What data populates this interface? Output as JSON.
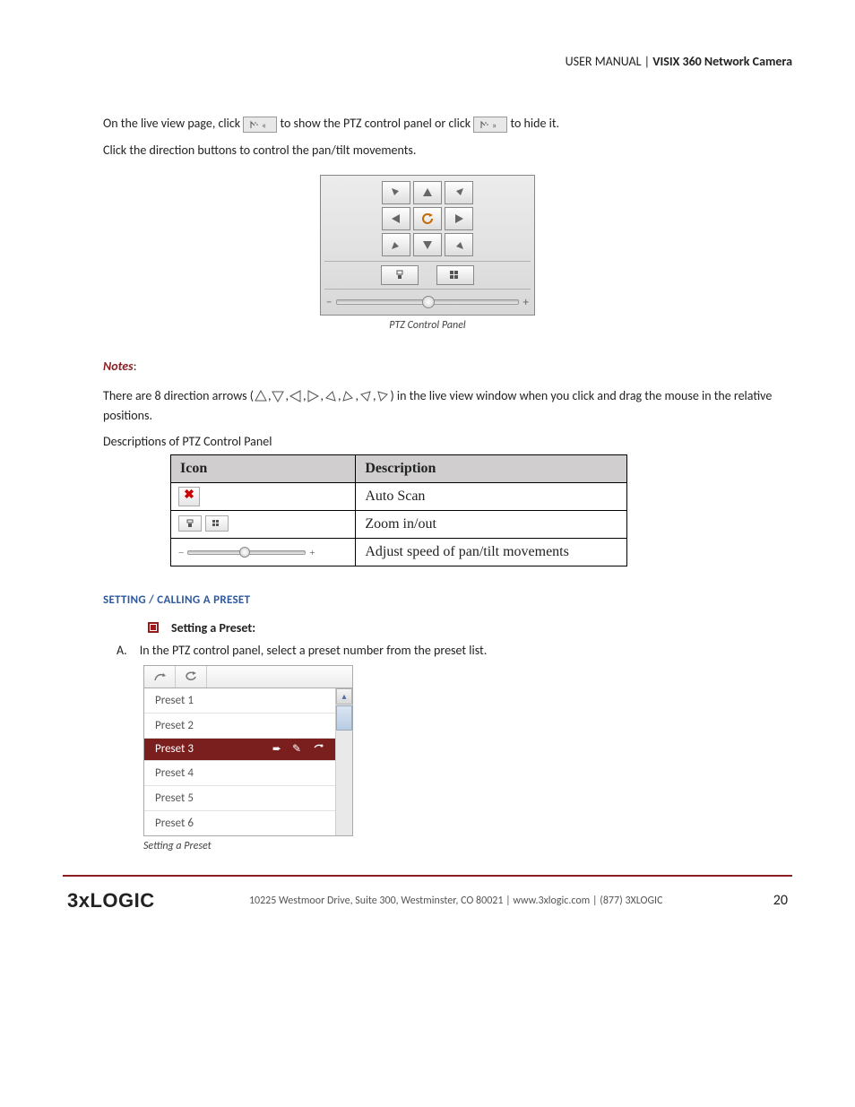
{
  "header": {
    "left": "USER MANUAL | ",
    "bold": "VISIX 360 Network Camera"
  },
  "paragraphs": {
    "p1a": "On the live view page, click ",
    "p1b": " to show the PTZ control panel or click ",
    "p1c": " to hide it.",
    "p2": "Click the direction buttons to control the pan/tilt movements.",
    "caption1": "PTZ Control Panel",
    "notes_label": "Notes",
    "notes_colon": ":",
    "p3a": "There are 8 direction arrows (",
    "p3b": ") in the live view window when you click and drag the mouse in the relative positions.",
    "p4": "Descriptions of PTZ Control Panel",
    "section": "SETTING / CALLING A PRESET",
    "bullet1": "Setting a Preset:",
    "stepA": "A. In the PTZ control panel, select a preset number from the preset list.",
    "caption2": "Setting a Preset"
  },
  "table": {
    "h1": "Icon",
    "h2": "Description",
    "r1": "Auto Scan",
    "r2": "Zoom in/out",
    "r3": "Adjust speed of pan/tilt movements"
  },
  "presets": [
    "Preset 1",
    "Preset 2",
    "Preset 3",
    "Preset 4",
    "Preset 5",
    "Preset 6"
  ],
  "footer": {
    "logo": "3xLOGIC",
    "text": "10225 Westmoor Drive, Suite 300, Westminster, CO 80021 | www.3xlogic.com | (877) 3XLOGIC",
    "page": "20"
  }
}
